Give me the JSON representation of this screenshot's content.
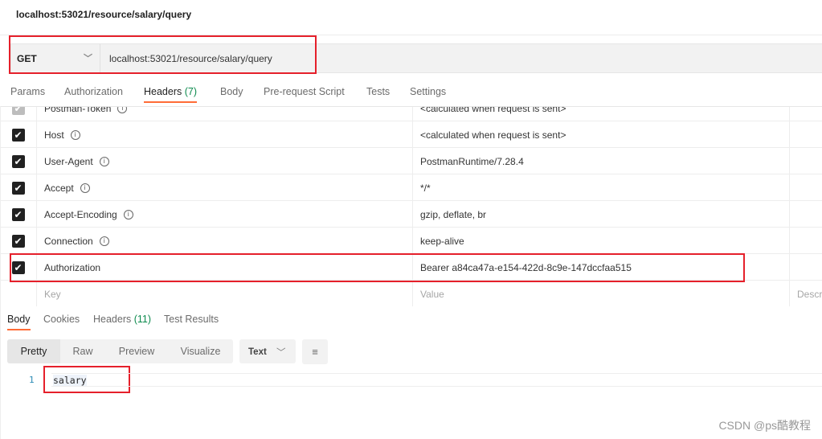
{
  "title": "localhost:53021/resource/salary/query",
  "request": {
    "method": "GET",
    "url": "localhost:53021/resource/salary/query"
  },
  "request_tabs": [
    {
      "label": "Params"
    },
    {
      "label": "Authorization"
    },
    {
      "label": "Headers",
      "count": "(7)"
    },
    {
      "label": "Body"
    },
    {
      "label": "Pre-request Script"
    },
    {
      "label": "Tests"
    },
    {
      "label": "Settings"
    }
  ],
  "headers": [
    {
      "key": "Postman-Token",
      "value": "<calculated when request is sent>",
      "checked": true,
      "disabled": true
    },
    {
      "key": "Host",
      "value": "<calculated when request is sent>",
      "checked": true
    },
    {
      "key": "User-Agent",
      "value": "PostmanRuntime/7.28.4",
      "checked": true
    },
    {
      "key": "Accept",
      "value": "*/*",
      "checked": true
    },
    {
      "key": "Accept-Encoding",
      "value": "gzip, deflate, br",
      "checked": true
    },
    {
      "key": "Connection",
      "value": "keep-alive",
      "checked": true
    },
    {
      "key": "Authorization",
      "value": "Bearer a84ca47a-e154-422d-8c9e-147dccfaa515",
      "checked": true
    }
  ],
  "placeholders": {
    "key": "Key",
    "value": "Value",
    "description": "Descr"
  },
  "response_tabs": [
    {
      "label": "Body"
    },
    {
      "label": "Cookies"
    },
    {
      "label": "Headers",
      "count": "(11)"
    },
    {
      "label": "Test Results"
    }
  ],
  "view_modes": [
    "Pretty",
    "Raw",
    "Preview",
    "Visualize"
  ],
  "format": "Text",
  "body": {
    "line": "1",
    "text": "salary"
  },
  "watermark": "CSDN @ps酷教程",
  "colors": {
    "accent": "#ff6c37",
    "highlight": "#e5202b",
    "count": "#0c8a4d"
  }
}
